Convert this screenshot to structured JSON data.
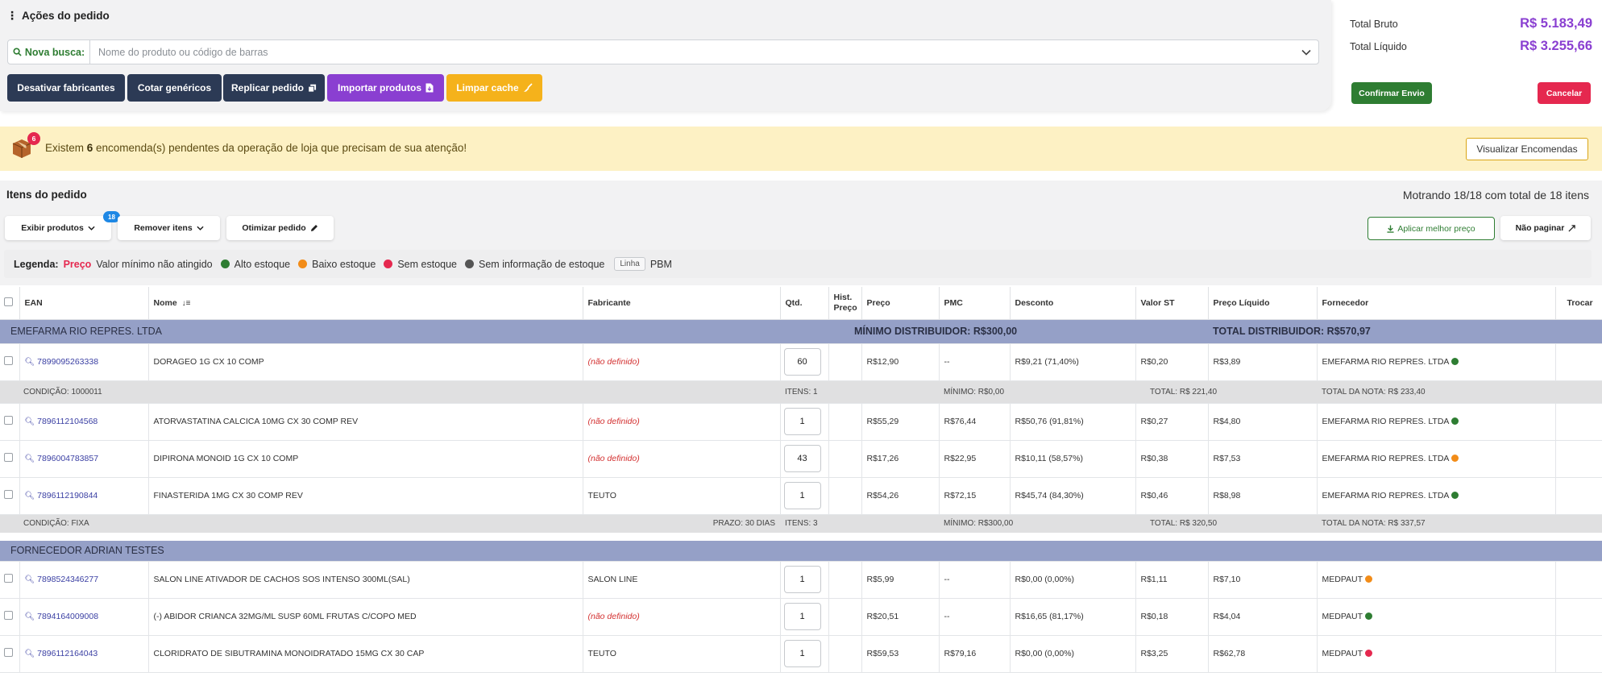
{
  "actions": {
    "title": "Ações do pedido",
    "search_label": "Nova busca:",
    "search_placeholder": "Nome do produto ou código de barras",
    "buttons": {
      "deactivate": "Desativar fabricantes",
      "generics": "Cotar genéricos",
      "replicate": "Replicar pedido",
      "import": "Importar produtos",
      "clear_cache": "Limpar cache"
    }
  },
  "totals": {
    "gross_label": "Total Bruto",
    "gross_value": "R$ 5.183,49",
    "net_label": "Total Líquido",
    "net_value": "R$ 3.255,66",
    "confirm": "Confirmar Envio",
    "cancel": "Cancelar"
  },
  "banner": {
    "badge": "6",
    "text_before": "Existem ",
    "count": "6",
    "text_after": " encomenda(s) pendentes da operação de loja que precisam de sua atenção!",
    "button": "Visualizar Encomendas"
  },
  "items": {
    "title": "Itens do pedido",
    "count_text": "Motrando 18/18 com total de 18 itens",
    "badge": "18",
    "show_products": "Exibir produtos",
    "remove_items": "Remover itens",
    "optimize": "Otimizar pedido",
    "apply_best": "Aplicar melhor preço",
    "no_paginate": "Não paginar"
  },
  "legend": {
    "label": "Legenda:",
    "price": "Preço",
    "price_desc": "Valor mínimo não atingido",
    "high": "Alto estoque",
    "low": "Baixo estoque",
    "none": "Sem estoque",
    "no_info": "Sem informação de estoque",
    "linha": "Linha",
    "pbm": "PBM"
  },
  "colors": {
    "green": "#2e7d32",
    "orange": "#f28c18",
    "red": "#e5284f",
    "gray": "#555555",
    "purple": "#8a3fd1"
  },
  "table": {
    "headers": {
      "ean": "EAN",
      "nome": "Nome",
      "fabricante": "Fabricante",
      "qtd": "Qtd.",
      "hist1": "Hist.",
      "hist2": "Preço",
      "preco": "Preço",
      "pmc": "PMC",
      "desconto": "Desconto",
      "valor_st": "Valor ST",
      "preco_liq": "Preço Líquido",
      "fornecedor": "Fornecedor",
      "trocar": "Trocar"
    },
    "groups": [
      {
        "name": "EMEFARMA RIO REPRES. LTDA",
        "min": "MÍNIMO DISTRIBUIDOR: R$300,00",
        "total": "TOTAL DISTRIBUIDOR: R$570,97"
      },
      {
        "name": "FORNECEDOR ADRIAN TESTES"
      }
    ],
    "rows": [
      {
        "ean": "7899095263338",
        "nome": "DORAGEO 1G CX 10 COMP",
        "fabricante": "(não definido)",
        "qtd": "60",
        "preco": "R$12,90",
        "pmc": "--",
        "desconto": "R$9,21 (71,40%)",
        "st": "R$0,20",
        "liq": "R$3,89",
        "fornecedor": "EMEFARMA RIO REPRES. LTDA",
        "stock": "green"
      },
      {
        "ean": "7896112104568",
        "nome": "ATORVASTATINA CALCICA 10MG CX 30 COMP REV",
        "fabricante": "(não definido)",
        "qtd": "1",
        "preco": "R$55,29",
        "pmc": "R$76,44",
        "desconto": "R$50,76 (91,81%)",
        "st": "R$0,27",
        "liq": "R$4,80",
        "fornecedor": "EMEFARMA RIO REPRES. LTDA",
        "stock": "green"
      },
      {
        "ean": "7896004783857",
        "nome": "DIPIRONA MONOID 1G CX 10 COMP",
        "fabricante": "(não definido)",
        "qtd": "43",
        "preco": "R$17,26",
        "pmc": "R$22,95",
        "desconto": "R$10,11 (58,57%)",
        "st": "R$0,38",
        "liq": "R$7,53",
        "fornecedor": "EMEFARMA RIO REPRES. LTDA",
        "stock": "orange"
      },
      {
        "ean": "7896112190844",
        "nome": "FINASTERIDA 1MG CX 30 COMP REV",
        "fabricante": "TEUTO",
        "qtd": "1",
        "preco": "R$54,26",
        "pmc": "R$72,15",
        "desconto": "R$45,74 (84,30%)",
        "st": "R$0,46",
        "liq": "R$8,98",
        "fornecedor": "EMEFARMA RIO REPRES. LTDA",
        "stock": "green"
      },
      {
        "ean": "7898524346277",
        "nome": "SALON LINE ATIVADOR DE CACHOS SOS INTENSO 300ML(SAL)",
        "fabricante": "SALON LINE",
        "qtd": "1",
        "preco": "R$5,99",
        "pmc": "--",
        "desconto": "R$0,00 (0,00%)",
        "st": "R$1,11",
        "liq": "R$7,10",
        "fornecedor": "MEDPAUT",
        "stock": "orange"
      },
      {
        "ean": "7894164009008",
        "nome": "(-) ABIDOR CRIANCA 32MG/ML SUSP 60ML FRUTAS C/COPO MED",
        "fabricante": "(não definido)",
        "qtd": "1",
        "preco": "R$20,51",
        "pmc": "--",
        "desconto": "R$16,65 (81,17%)",
        "st": "R$0,18",
        "liq": "R$4,04",
        "fornecedor": "MEDPAUT",
        "stock": "green"
      },
      {
        "ean": "7896112164043",
        "nome": "CLORIDRATO DE SIBUTRAMINA MONOIDRATADO 15MG CX 30 CAP",
        "fabricante": "TEUTO",
        "qtd": "1",
        "preco": "R$59,53",
        "pmc": "R$79,16",
        "desconto": "R$0,00 (0,00%)",
        "st": "R$3,25",
        "liq": "R$62,78",
        "fornecedor": "MEDPAUT",
        "stock": "red"
      }
    ],
    "conditions": [
      {
        "cond": "CONDIÇÃO: 1000011",
        "prazo": "",
        "itens": "ITENS: 1",
        "min": "MÍNIMO: R$0,00",
        "total": "TOTAL: R$ 221,40",
        "nota": "TOTAL DA NOTA: R$ 233,40"
      },
      {
        "cond": "CONDIÇÃO: FIXA",
        "prazo": "PRAZO: 30 DIAS",
        "itens": "ITENS: 3",
        "min": "MÍNIMO: R$300,00",
        "total": "TOTAL: R$ 320,50",
        "nota": "TOTAL DA NOTA: R$ 337,57"
      }
    ]
  }
}
